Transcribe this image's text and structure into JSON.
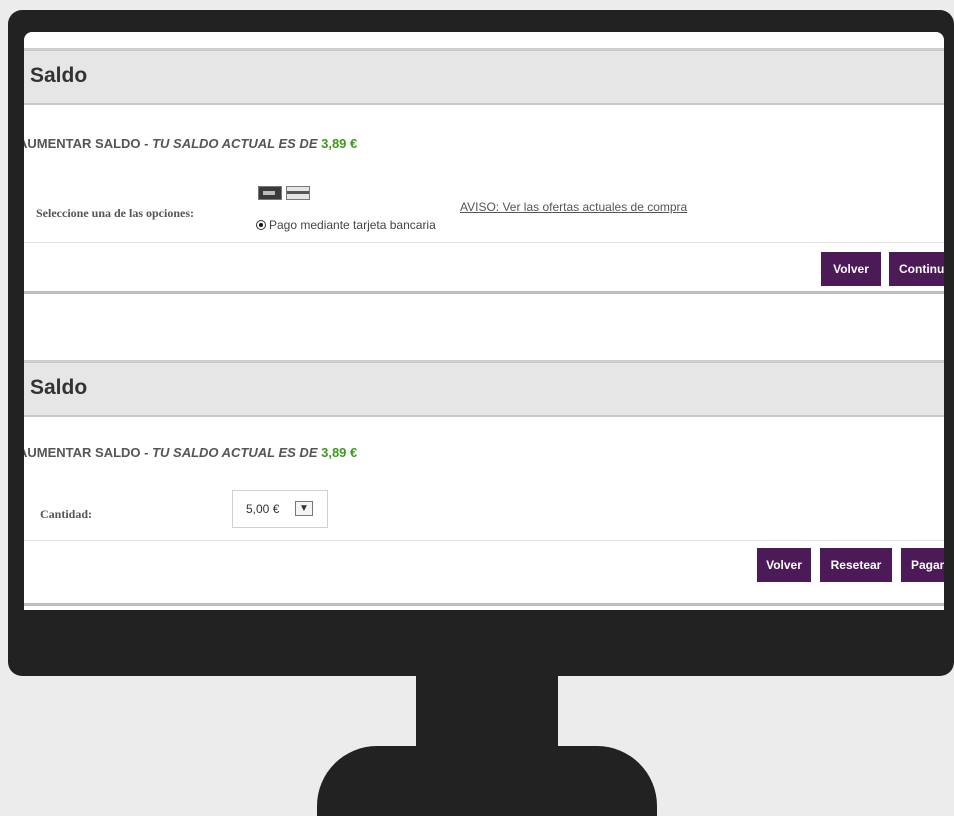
{
  "panels": [
    {
      "title": "Saldo",
      "balance_prefix": "AUMENTAR SALDO - ",
      "balance_italic": "TU SALDO ACTUAL ES DE ",
      "balance_amount": "3,89 €",
      "label": "Seleccione una de las opciones:",
      "payment_option": "Pago mediante tarjeta bancaria",
      "aviso_link": "AVISO: Ver las ofertas actuales de compra",
      "buttons": {
        "back": "Volver",
        "continue": "Continuar"
      }
    },
    {
      "title": "Saldo",
      "balance_prefix": "AUMENTAR SALDO - ",
      "balance_italic": "TU SALDO ACTUAL ES DE ",
      "balance_amount": "3,89 €",
      "label": "Cantidad:",
      "quantity_value": "5,00 €",
      "buttons": {
        "back": "Volver",
        "reset": "Resetear",
        "pay": "Pagar"
      }
    }
  ],
  "colors": {
    "button_bg": "#4b1a57",
    "amount_green": "#3d9a1d",
    "header_bg": "#e6e6e6",
    "monitor": "#222222"
  }
}
